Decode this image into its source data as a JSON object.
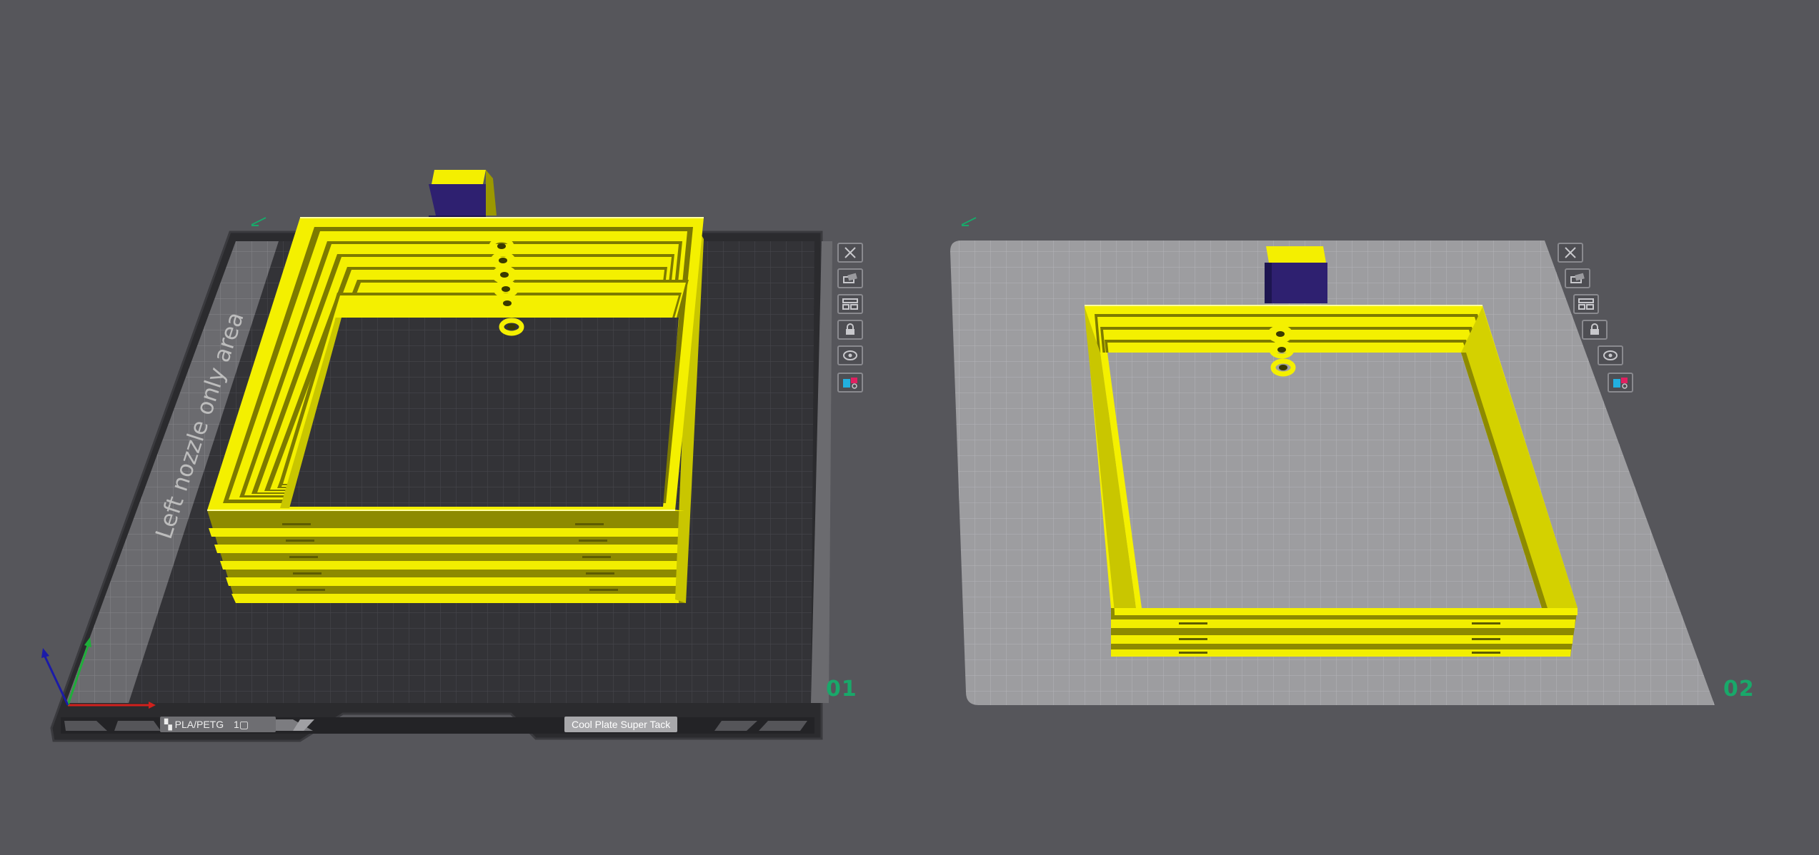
{
  "plates": [
    {
      "number": "01",
      "active": true
    },
    {
      "number": "02",
      "active": false
    }
  ],
  "bed_region_label": "Left nozzle only area",
  "bed_labels": {
    "filament": "PLA/PETG",
    "filament_count": "1",
    "plate_type": "Cool Plate Super Tack"
  },
  "plate_toolbar_icons": [
    "close-icon",
    "auto-orient-icon",
    "arrange-icon",
    "lock-icon",
    "settings-icon",
    "plate-color-icon"
  ],
  "colors": {
    "background": "#56565b",
    "model_yellow": "#f2ee00",
    "wipe_tower_purple": "#2e2070",
    "plate_number_green": "#19a86a",
    "axis_x": "#d0201c",
    "axis_y": "#1fae3a",
    "axis_z": "#1b1ba8"
  }
}
